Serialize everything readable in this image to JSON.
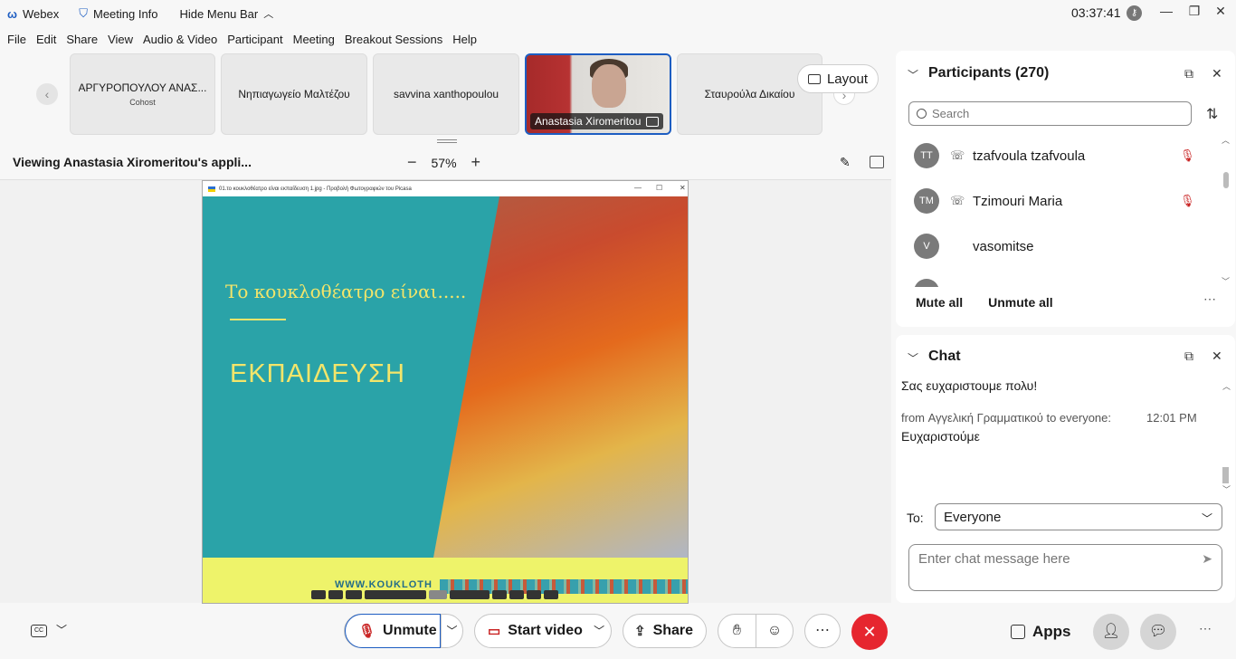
{
  "titlebar": {
    "app_name": "Webex",
    "meeting_info": "Meeting Info",
    "hide_menu": "Hide Menu Bar",
    "clock": "03:37:41"
  },
  "menu": [
    "File",
    "Edit",
    "Share",
    "View",
    "Audio & Video",
    "Participant",
    "Meeting",
    "Breakout Sessions",
    "Help"
  ],
  "filmstrip": {
    "tiles": [
      {
        "name": "ΑΡΓΥΡΟΠΟΥΛΟΥ ΑΝΑΣ...",
        "role": "Cohost"
      },
      {
        "name": "Νηπιαγωγείο Μαλτέζου"
      },
      {
        "name": "savvina xanthopoulou"
      },
      {
        "name": "Anastasia Xiromeritou"
      },
      {
        "name": "Σταυρούλα Δικαίου"
      }
    ],
    "layout_label": "Layout"
  },
  "viewing": {
    "text": "Viewing Anastasia Xiromeritou's appli...",
    "zoom": "57%"
  },
  "shared_image": {
    "window_title": "01.το κουκλοθέατρο είναι εκπαίδευση 1.jpg - Προβολή Φωτογραφιών του Picasa",
    "headline": "Το κουκλοθέατρο είναι.....",
    "word": "ΕΚΠΑΙΔΕΥΣΗ",
    "url": "WWW.KOUKLOTH"
  },
  "participants": {
    "title": "Participants (270)",
    "search_placeholder": "Search",
    "list": [
      {
        "initials": "TT",
        "name": "tzafvoula tzafvoula"
      },
      {
        "initials": "TM",
        "name": "Tzimouri Maria"
      },
      {
        "initials": "V",
        "name": "vasomitse"
      }
    ],
    "mute_all": "Mute all",
    "unmute_all": "Unmute all"
  },
  "chat": {
    "title": "Chat",
    "message1": "Σας ευχαριστουμε πολυ!",
    "meta": "from Αγγελική Γραμματικού to everyone:",
    "time": "12:01 PM",
    "message2": "Ευχαριστούμε",
    "to_label": "To:",
    "to_value": "Everyone",
    "input_placeholder": "Enter chat message here"
  },
  "toolbar": {
    "unmute": "Unmute",
    "start_video": "Start video",
    "share": "Share",
    "apps": "Apps"
  },
  "colors": {
    "accent": "#1d5dc2",
    "end_call": "#e6262f",
    "muted": "#c92323"
  }
}
